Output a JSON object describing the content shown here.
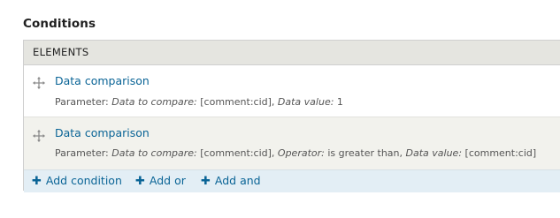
{
  "section": {
    "title": "Conditions"
  },
  "panel": {
    "header": "ELEMENTS",
    "rows": [
      {
        "title": "Data comparison",
        "parameter_label": "Parameter:",
        "parts": [
          {
            "key": "Data to compare:",
            "value": "[comment:cid],"
          },
          {
            "key": "Data value:",
            "value": "1"
          }
        ]
      },
      {
        "title": "Data comparison",
        "parameter_label": "Parameter:",
        "parts": [
          {
            "key": "Data to compare:",
            "value": "[comment:cid],"
          },
          {
            "key": "Operator:",
            "value": "is greater than,"
          },
          {
            "key": "Data value:",
            "value": "[comment:cid]"
          }
        ]
      }
    ],
    "actions": {
      "add_condition": "Add condition",
      "add_or": "Add or",
      "add_and": "Add and"
    }
  },
  "icons": {
    "drag_handle": "move-icon",
    "add": "plus-icon"
  },
  "colors": {
    "link": "#0a6496",
    "header_bg": "#e5e5e0",
    "row_alt_bg": "#f2f2ed",
    "footer_bg": "#e3eef5"
  }
}
